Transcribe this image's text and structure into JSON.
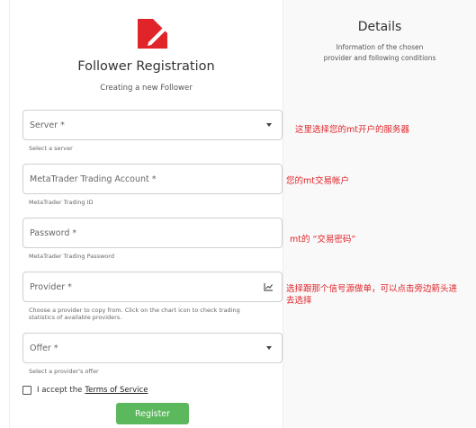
{
  "brand": {
    "logo_icon": "brand-logo-icon",
    "accent_color": "#e0242a"
  },
  "header": {
    "title": "Follower Registration",
    "subtitle": "Creating a new Follower"
  },
  "form": {
    "server": {
      "placeholder": "Server *",
      "helper": "Select a server"
    },
    "account": {
      "placeholder": "MetaTrader Trading Account *",
      "helper": "MetaTrader Trading ID"
    },
    "password": {
      "placeholder": "Password *",
      "helper": "MetaTrader Trading Password"
    },
    "provider": {
      "placeholder": "Provider *",
      "helper_line1": "Choose a provider to copy from. Click on the chart icon to check trading",
      "helper_line2": "statistics of available providers.",
      "icon": "chart-icon"
    },
    "offer": {
      "placeholder": "Offer *",
      "helper": "Select a provider's offer"
    },
    "terms": {
      "prefix": "I accept the",
      "link": "Terms of Service"
    },
    "register_label": "Register"
  },
  "annotations": {
    "server": "这里选择您的mt开户的服务器",
    "account": "您的mt交易帐户",
    "password": "mt的 “交易密码”",
    "provider_line1": "选择跟那个信号源做单，可以点击旁边箭头进",
    "provider_line2": "去选择"
  },
  "details": {
    "title": "Details",
    "text_line1": "Information of the chosen",
    "text_line2": "provider and following conditions"
  },
  "colors": {
    "register_button": "#5cb85c",
    "annotation": "#e0242a"
  }
}
